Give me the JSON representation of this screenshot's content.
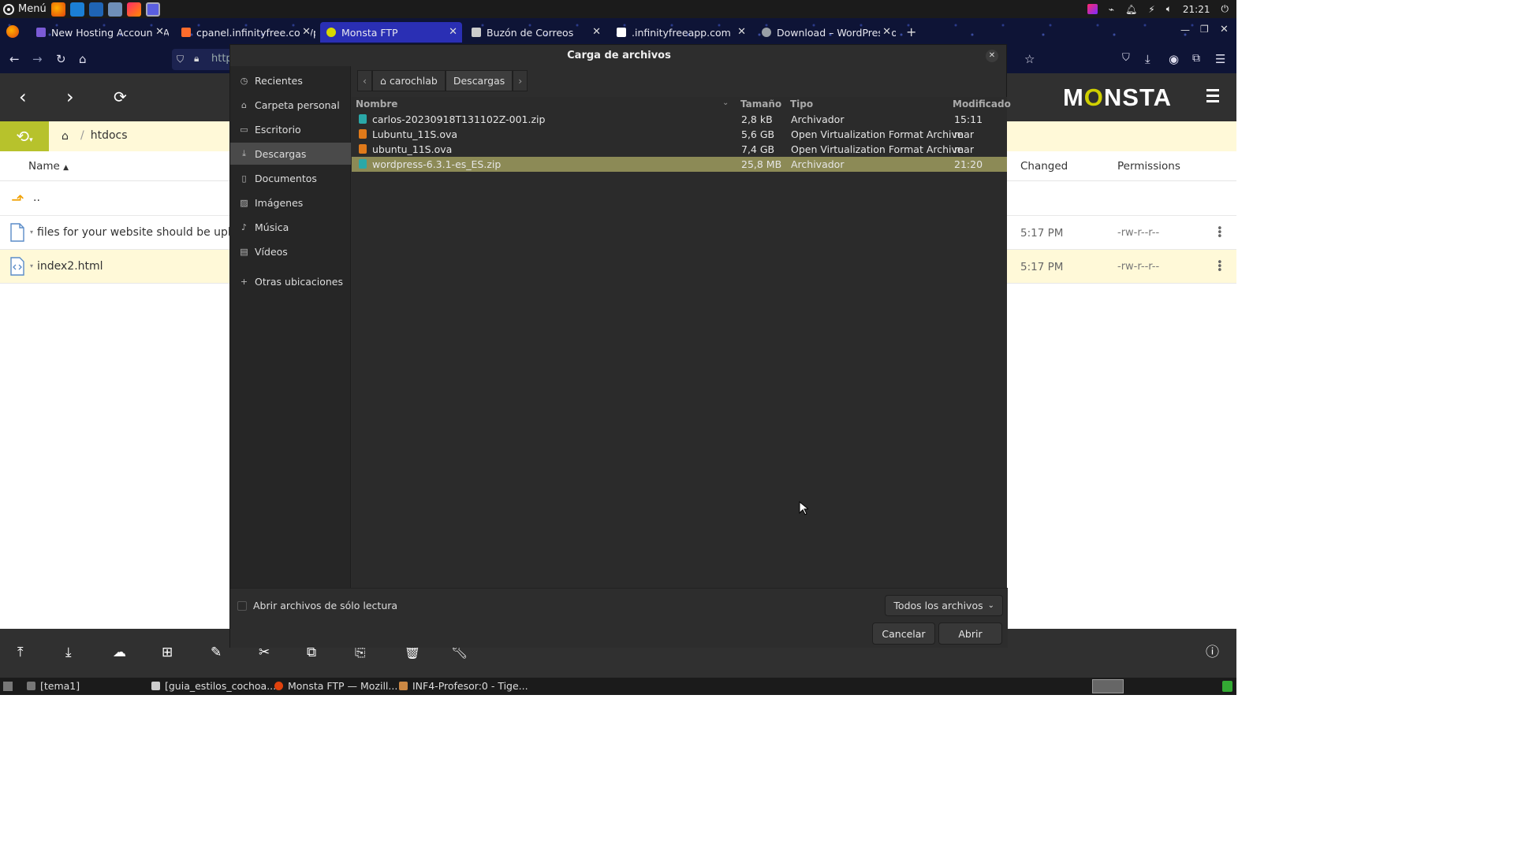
{
  "top_panel": {
    "menu_label": "Menú",
    "clock": "21:21"
  },
  "browser": {
    "tabs": [
      {
        "title": "New Hosting Account: Ac",
        "color": "#7b5bd6"
      },
      {
        "title": "cpanel.infinityfree.com/p",
        "color": "#ff6c2c"
      },
      {
        "title": "Monsta FTP",
        "color": "#d8d800"
      },
      {
        "title": "Buzón de Correos",
        "color": "#cccccc"
      },
      {
        "title": ".infinityfreeapp.com",
        "color": "#ffffff"
      },
      {
        "title": "Download – WordPress.o",
        "color": "#9aa0a6"
      }
    ],
    "url_partial": "http"
  },
  "monsta": {
    "logo_pre": "M",
    "logo_o": "O",
    "logo_post": "NSTA",
    "path": "htdocs",
    "columns": {
      "name": "Name",
      "changed": "Changed",
      "permissions": "Permissions"
    },
    "parent_dir": "..",
    "files": [
      {
        "name": "files for your website should be uploa",
        "changed": "5:17 PM",
        "permissions": "-rw-r--r--"
      },
      {
        "name": "index2.html",
        "changed": "5:17 PM",
        "permissions": "-rw-r--r--"
      }
    ]
  },
  "dialog": {
    "title": "Carga de archivos",
    "places": [
      "Recientes",
      "Carpeta personal",
      "Escritorio",
      "Descargas",
      "Documentos",
      "Imágenes",
      "Música",
      "Vídeos",
      "Otras ubicaciones"
    ],
    "path_segments": [
      "carochlab",
      "Descargas"
    ],
    "headers": {
      "name": "Nombre",
      "size": "Tamaño",
      "type": "Tipo",
      "modified": "Modificado"
    },
    "files": [
      {
        "name": "carlos-20230918T131102Z-001.zip",
        "size": "2,8 kB",
        "type": "Archivador",
        "modified": "15:11"
      },
      {
        "name": "Lubuntu_11S.ova",
        "size": "5,6 GB",
        "type": "Open Virtualization Format Archive",
        "modified": "mar"
      },
      {
        "name": "ubuntu_11S.ova",
        "size": "7,4 GB",
        "type": "Open Virtualization Format Archive",
        "modified": "mar"
      },
      {
        "name": "wordpress-6.3.1-es_ES.zip",
        "size": "25,8 MB",
        "type": "Archivador",
        "modified": "21:20"
      }
    ],
    "readonly_label": "Abrir archivos de sólo lectura",
    "filter_label": "Todos los archivos",
    "cancel_label": "Cancelar",
    "open_label": "Abrir"
  },
  "taskbar": {
    "items": [
      "[tema1]",
      "[guia_estilos_cochoa....",
      "Monsta FTP — Mozill...",
      "INF4-Profesor:0 - Tige..."
    ]
  }
}
